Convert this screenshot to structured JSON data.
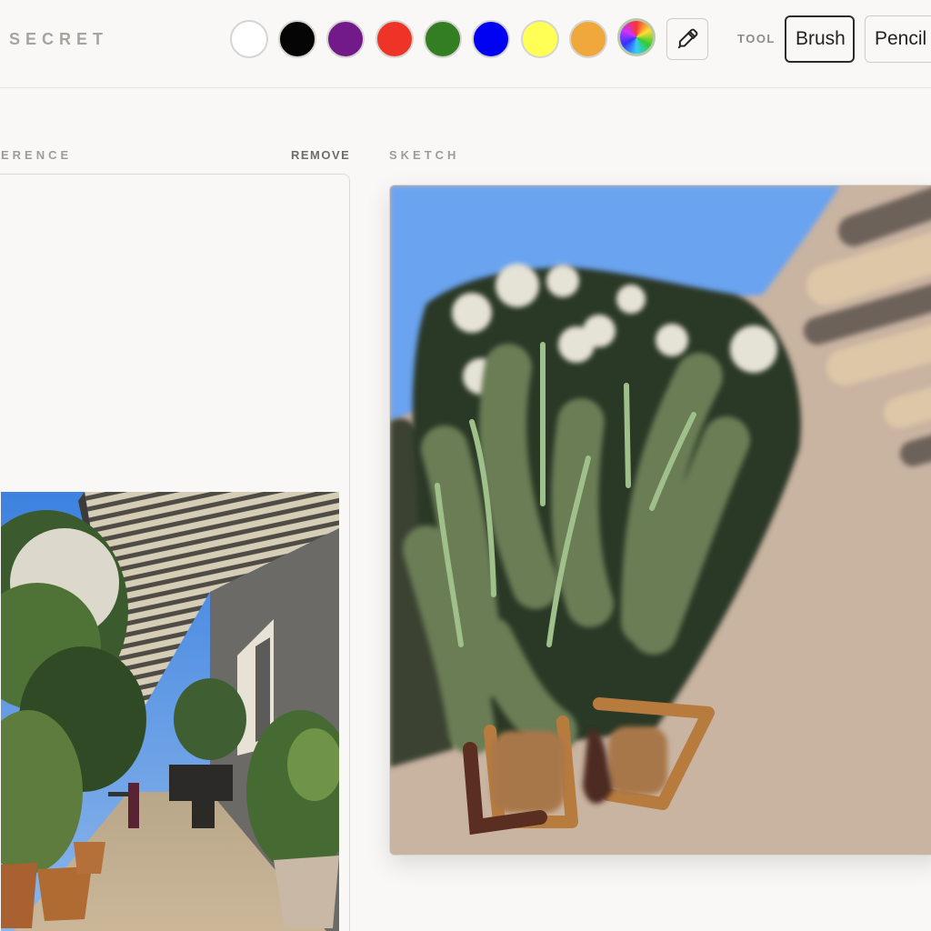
{
  "app": {
    "brand": "SECRET"
  },
  "palette": {
    "colors": [
      {
        "name": "white",
        "hex": "#ffffff"
      },
      {
        "name": "black",
        "hex": "#050505"
      },
      {
        "name": "purple",
        "hex": "#731a8a"
      },
      {
        "name": "red",
        "hex": "#ee3426"
      },
      {
        "name": "green",
        "hex": "#337d22"
      },
      {
        "name": "blue",
        "hex": "#0202f2"
      },
      {
        "name": "yellow",
        "hex": "#ffff55"
      },
      {
        "name": "orange",
        "hex": "#f0a73b"
      }
    ],
    "custom_color_icon": "color-wheel-icon",
    "eyedropper_icon": "eyedropper-icon"
  },
  "tools": {
    "label": "TOOL",
    "options": [
      {
        "label": "Brush",
        "active": true
      },
      {
        "label": "Pencil",
        "active": false
      }
    ]
  },
  "reference": {
    "label": "REFERENCE",
    "remove_label": "REMOVE"
  },
  "sketch": {
    "label": "SKETCH"
  }
}
